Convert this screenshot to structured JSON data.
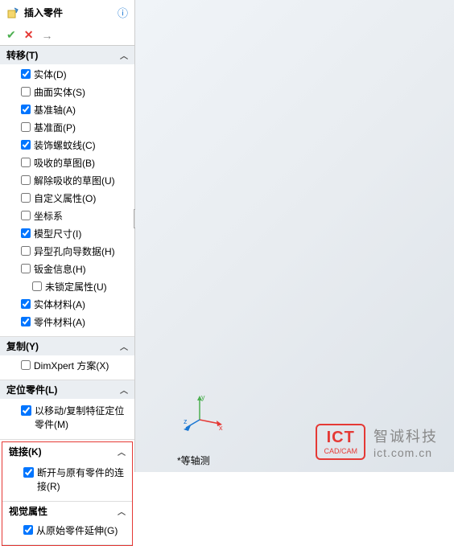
{
  "header": {
    "title": "插入零件"
  },
  "sections": {
    "transfer": {
      "title": "转移(T)",
      "items": [
        {
          "label": "实体(D)",
          "checked": true
        },
        {
          "label": "曲面实体(S)",
          "checked": false
        },
        {
          "label": "基准轴(A)",
          "checked": true
        },
        {
          "label": "基准面(P)",
          "checked": false
        },
        {
          "label": "装饰螺蚊线(C)",
          "checked": true
        },
        {
          "label": "吸收的草图(B)",
          "checked": false
        },
        {
          "label": "解除吸收的草图(U)",
          "checked": false
        },
        {
          "label": "自定义属性(O)",
          "checked": false
        },
        {
          "label": "坐标系",
          "checked": false
        },
        {
          "label": "模型尺寸(I)",
          "checked": true
        },
        {
          "label": "异型孔向导数据(H)",
          "checked": false
        },
        {
          "label": "钣金信息(H)",
          "checked": false
        },
        {
          "label": "未锁定属性(U)",
          "checked": false,
          "indent": true
        },
        {
          "label": "实体材料(A)",
          "checked": true
        },
        {
          "label": "零件材料(A)",
          "checked": true
        }
      ]
    },
    "copy": {
      "title": "复制(Y)",
      "items": [
        {
          "label": "DimXpert 方案(X)",
          "checked": false
        }
      ]
    },
    "locate": {
      "title": "定位零件(L)",
      "items": [
        {
          "label": "以移动/复制特征定位零件(M)",
          "checked": true
        }
      ]
    },
    "link": {
      "title": "链接(K)",
      "items": [
        {
          "label": "断开与原有零件的连接(R)",
          "checked": true
        }
      ]
    },
    "visual": {
      "title": "视觉属性",
      "items": [
        {
          "label": "从原始零件延伸(G)",
          "checked": true
        }
      ]
    }
  },
  "status": "*等轴测",
  "logo": {
    "badge_big": "ICT",
    "badge_small": "CAD/CAM",
    "cn": "智诚科技",
    "en": "ict.com.cn"
  },
  "triad": {
    "x": "x",
    "y": "y",
    "z": "z"
  }
}
